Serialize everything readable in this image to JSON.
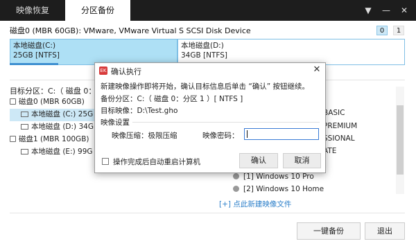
{
  "tabs": {
    "restore": "映像恢复",
    "backup": "分区备份"
  },
  "window": {
    "menu": "▼",
    "minimize": "—",
    "close": "✕"
  },
  "disk0": {
    "title": "磁盘0 (MBR 60GB): VMware, VMware Virtual S SCSI Disk Device",
    "page1": "0",
    "page2": "1",
    "partitions": [
      {
        "name": "本地磁盘(C:)",
        "info": "25GB [NTFS]"
      },
      {
        "name": "本地磁盘(D:)",
        "info": "34GB [NTFS]"
      }
    ]
  },
  "tree": {
    "target_label": "目标分区：C:（ 磁盘 0：",
    "rows": [
      {
        "type": "disk",
        "text": "磁盘0 (MBR 60GB)"
      },
      {
        "type": "part",
        "text": "本地磁盘 (C:) 25G"
      },
      {
        "type": "part",
        "text": "本地磁盘 (D:) 34G"
      },
      {
        "type": "disk",
        "text": "磁盘1 (MBR 100GB)"
      },
      {
        "type": "part",
        "text": "本地磁盘 (E:) 99G"
      }
    ]
  },
  "editions": [
    "BASIC",
    "PREMIUM",
    "SSIONAL",
    "ATE"
  ],
  "images": [
    {
      "label": "[1] Windows 10 Pro"
    },
    {
      "label": "[2] Windows 10 Home"
    }
  ],
  "add_image": "[+] 点此新建映像文件",
  "buttons": {
    "backup": "一键备份",
    "exit": "退出"
  },
  "dialog": {
    "logo": "EK",
    "title": "确认执行",
    "close": "✕",
    "line1": "新建映像操作即将开始，确认目标信息后单击 “确认” 按钮继续。",
    "source_label": "备份分区：",
    "source_value": "C:（ 磁盘 0：分区 1 ）[ NTFS ]",
    "target_label": "目标映像：",
    "target_value": "D:\\Test.gho",
    "settings": "映像设置",
    "compress_label": "映像压缩：",
    "compress_value": "极限压缩",
    "password_label": "映像密码：",
    "password_value": "",
    "restart_option": "操作完成后自动重启计算机",
    "ok": "确认",
    "cancel": "取消"
  }
}
